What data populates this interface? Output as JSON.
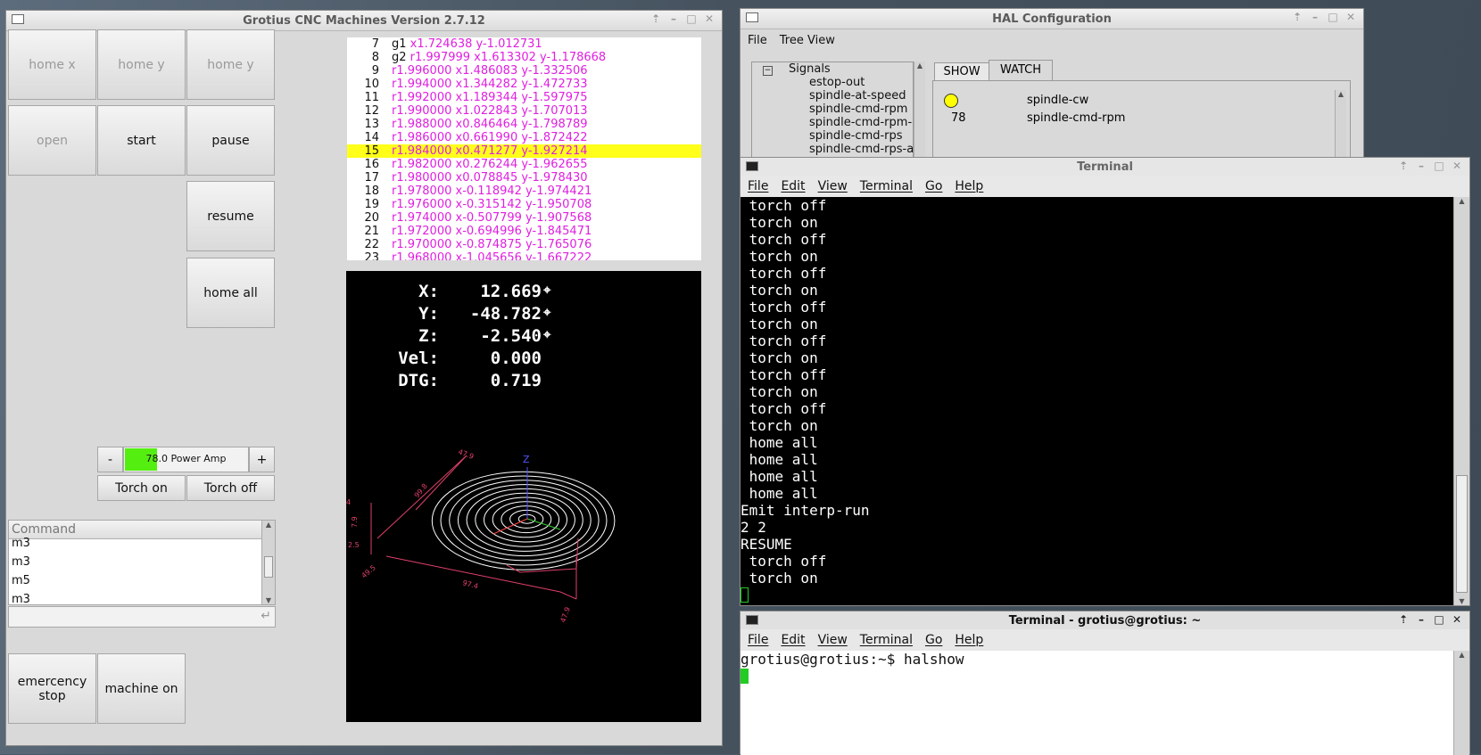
{
  "cnc": {
    "title": "Grotius CNC Machines Version 2.7.12",
    "buttons": {
      "home_x": "home x",
      "home_y": "home y",
      "home_y2": "home y",
      "open": "open",
      "start": "start",
      "pause": "pause",
      "resume": "resume",
      "home_all": "home all",
      "minus": "-",
      "plus": "+",
      "torch_on": "Torch on",
      "torch_off": "Torch off",
      "estop": "emercency stop",
      "machine_on": "machine on"
    },
    "power": {
      "label": "78.0 Power Amp",
      "value": 78,
      "bar_color": "#55ee11"
    },
    "command": {
      "header": "Command",
      "history": [
        "m3",
        "m3",
        "m5",
        "m3"
      ],
      "input_value": ""
    },
    "gcode": [
      {
        "num": "7",
        "cmd": "g1",
        "args": "x1.724638 y-1.012731"
      },
      {
        "num": "8",
        "cmd": "g2",
        "args": "r1.997999 x1.613302 y-1.178668"
      },
      {
        "num": "9",
        "cmd": "",
        "args": "r1.996000 x1.486083 y-1.332506"
      },
      {
        "num": "10",
        "cmd": "",
        "args": "r1.994000 x1.344282 y-1.472733"
      },
      {
        "num": "11",
        "cmd": "",
        "args": "r1.992000 x1.189344 y-1.597975"
      },
      {
        "num": "12",
        "cmd": "",
        "args": "r1.990000 x1.022843 y-1.707013"
      },
      {
        "num": "13",
        "cmd": "",
        "args": "r1.988000 x0.846464 y-1.798789"
      },
      {
        "num": "14",
        "cmd": "",
        "args": "r1.986000 x0.661990 y-1.872422"
      },
      {
        "num": "15",
        "cmd": "",
        "args": "r1.984000 x0.471277 y-1.927214",
        "highlight": true
      },
      {
        "num": "16",
        "cmd": "",
        "args": "r1.982000 x0.276244 y-1.962655"
      },
      {
        "num": "17",
        "cmd": "",
        "args": "r1.980000 x0.078845 y-1.978430"
      },
      {
        "num": "18",
        "cmd": "",
        "args": "r1.978000 x-0.118942 y-1.974421"
      },
      {
        "num": "19",
        "cmd": "",
        "args": "r1.976000 x-0.315142 y-1.950708"
      },
      {
        "num": "20",
        "cmd": "",
        "args": "r1.974000 x-0.507799 y-1.907568"
      },
      {
        "num": "21",
        "cmd": "",
        "args": "r1.972000 x-0.694996 y-1.845471"
      },
      {
        "num": "22",
        "cmd": "",
        "args": "r1.970000 x-0.874875 y-1.765076"
      },
      {
        "num": "23",
        "cmd": "",
        "args": "r1.968000 x-1.045656 y-1.667222"
      }
    ],
    "dro": [
      {
        "label": "X:",
        "value": "12.669",
        "marker": true
      },
      {
        "label": "Y:",
        "value": "-48.782",
        "marker": true
      },
      {
        "label": "Z:",
        "value": "-2.540",
        "marker": true
      },
      {
        "label": "Vel:",
        "value": "0.000",
        "marker": false
      },
      {
        "label": "DTG:",
        "value": "0.719",
        "marker": false
      }
    ],
    "preview": {
      "axis_label": "Z",
      "dims": [
        "47.9",
        "99.8",
        "4",
        "7.9",
        "2.5",
        "49.5",
        "97.4",
        "47.9"
      ]
    }
  },
  "hal": {
    "title": "HAL Configuration",
    "menu": [
      "File",
      "Tree View"
    ],
    "tree_root": "Signals",
    "signals": [
      "estop-out",
      "spindle-at-speed",
      "spindle-cmd-rpm",
      "spindle-cmd-rpm-abs",
      "spindle-cmd-rps",
      "spindle-cmd-rps-abs"
    ],
    "tabs": [
      "SHOW",
      "WATCH"
    ],
    "watch": [
      {
        "value": "",
        "name": "spindle-cw",
        "led": true,
        "led_color": "#ffff00"
      },
      {
        "value": "78",
        "name": "spindle-cmd-rpm",
        "led": false
      }
    ]
  },
  "terminal1": {
    "title": "Terminal",
    "menu": [
      "File",
      "Edit",
      "View",
      "Terminal",
      "Go",
      "Help"
    ],
    "lines": [
      " torch off",
      " torch on",
      " torch off",
      " torch on",
      " torch off",
      " torch on",
      " torch off",
      " torch on",
      " torch off",
      " torch on",
      " torch off",
      " torch on",
      " torch off",
      " torch on",
      " home all",
      " home all",
      " home all",
      " home all",
      "Emit interp-run",
      "2 2",
      "RESUME",
      " torch off",
      " torch on"
    ]
  },
  "terminal2": {
    "title": "Terminal - grotius@grotius: ~",
    "menu": [
      "File",
      "Edit",
      "View",
      "Terminal",
      "Go",
      "Help"
    ],
    "lines": [
      "grotius@grotius:~$ halshow"
    ]
  },
  "colors": {
    "gcode_args": "#e020e0",
    "highlight": "#ffff1a",
    "cursor": "#22cc22",
    "preview_path": "#ffffff",
    "preview_dims": "#e0406a"
  }
}
